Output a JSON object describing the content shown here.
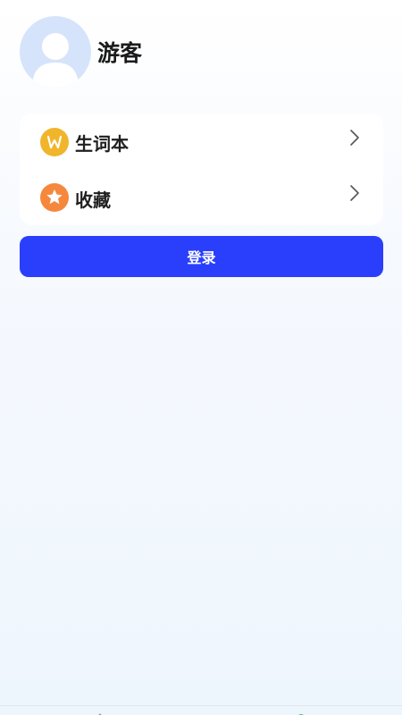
{
  "profile": {
    "username": "游客",
    "avatar_icon": "user-avatar-placeholder-icon",
    "avatar_color": "#d6e4fb"
  },
  "menu": {
    "items": [
      {
        "label": "生词本",
        "icon": "vocabulary-book-icon",
        "icon_color": "#f0b52a"
      },
      {
        "label": "收藏",
        "icon": "star-icon",
        "icon_color": "#f5883c"
      }
    ]
  },
  "login": {
    "label": "登录",
    "color": "#2a3ffb"
  },
  "tabbar": {
    "tabs": [
      {
        "icon": "home-icon",
        "active": false
      },
      {
        "icon": "profile-icon",
        "active": true,
        "color": "#2bb24c"
      }
    ]
  }
}
